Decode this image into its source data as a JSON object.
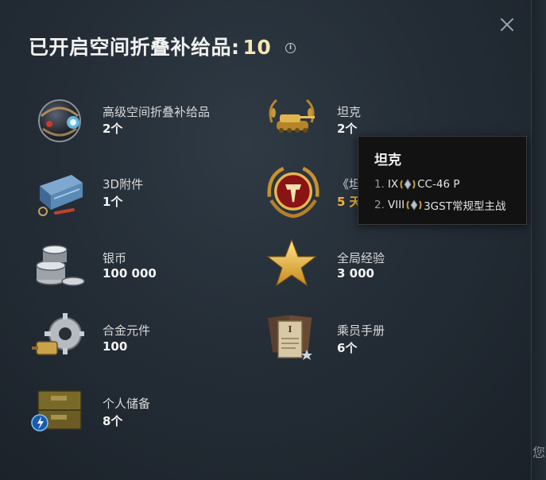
{
  "title": {
    "text": "已开启空间折叠补给品:",
    "count": "10"
  },
  "items": [
    {
      "label": "高级空间折叠补给品",
      "value": "2个",
      "icon": "space-fold-sphere-icon"
    },
    {
      "label": "坦克",
      "value": "2个",
      "icon": "tank-icon"
    },
    {
      "label": "3D附件",
      "value": "1个",
      "icon": "3d-attachment-crate-icon"
    },
    {
      "label": "《坦",
      "value": "5 天",
      "icon": "wot-premium-emblem-icon"
    },
    {
      "label": "银币",
      "value": "100 000",
      "icon": "silver-coins-icon"
    },
    {
      "label": "全局经验",
      "value": "3 000",
      "icon": "star-icon"
    },
    {
      "label": "合金元件",
      "value": "100",
      "icon": "gear-alloy-icon"
    },
    {
      "label": "乘员手册",
      "value": "6个",
      "icon": "crew-book-icon"
    },
    {
      "label": "个人储备",
      "value": "8个",
      "icon": "personal-reserve-crate-icon"
    }
  ],
  "tooltip": {
    "title": "坦克",
    "rows": [
      {
        "num": "1.",
        "tier": "IX",
        "name": "CC-46 P"
      },
      {
        "num": "2.",
        "tier": "VIII",
        "name": "3GST常规型主战"
      }
    ]
  },
  "side_text": "您",
  "colors": {
    "accent_gold": "#f0b33a",
    "count_cream": "#f5e6b4"
  }
}
